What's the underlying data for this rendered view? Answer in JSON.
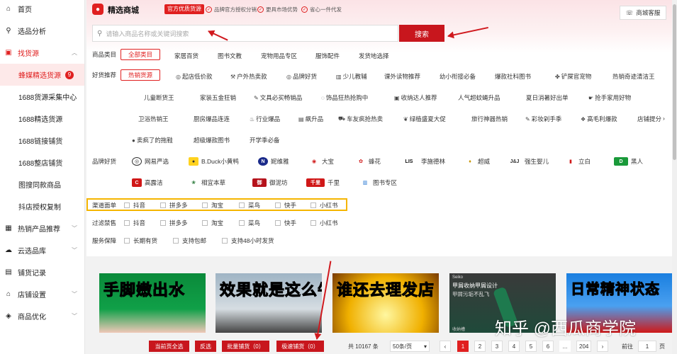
{
  "sidebar": {
    "items": [
      {
        "label": "首页",
        "icon": "home-icon"
      },
      {
        "label": "选品分析",
        "icon": "search-icon"
      },
      {
        "label": "找货源",
        "icon": "box-icon"
      },
      {
        "label": "热销产品推荐",
        "icon": "grid-icon"
      },
      {
        "label": "云选品库",
        "icon": "cloud-icon"
      },
      {
        "label": "铺货记录",
        "icon": "record-icon"
      },
      {
        "label": "店铺设置",
        "icon": "store-icon"
      },
      {
        "label": "商品优化",
        "icon": "optimize-icon"
      }
    ],
    "subitems": [
      {
        "label": "蜂媒精选货源",
        "badge": "9"
      },
      {
        "label": "1688货源采集中心"
      },
      {
        "label": "1688精选货源"
      },
      {
        "label": "1688链接铺货"
      },
      {
        "label": "1688整店铺货"
      },
      {
        "label": "图搜同款商品"
      },
      {
        "label": "抖店授权复制"
      }
    ]
  },
  "header": {
    "brand": "精选商城",
    "tag": "官方优质货源",
    "promos": [
      "品牌官方授权分销",
      "更具市场优势",
      "省心一件代发"
    ],
    "service": "商城客服"
  },
  "search": {
    "placeholder": "请输入商品名称或关键词搜索",
    "button": "搜索"
  },
  "category": {
    "label": "商品类目",
    "active": "全部类目",
    "options": [
      "家居百货",
      "图书文教",
      "宠物用品专区",
      "服饰配件",
      "发货地选择"
    ]
  },
  "recommend": {
    "label": "好货推荐",
    "active": "热销货源",
    "row1": [
      "起店低价款",
      "户外热卖款",
      "品牌好货",
      "少儿教辅",
      "课外读物推荐",
      "幼小衔接必备",
      "爆款社科图书",
      "铲屎官宠物",
      "热销奇迹清洁王"
    ],
    "row2": [
      "儿童断货王",
      "家装五金狂销",
      "文具必买畅销品",
      "饰品狂热抢购中",
      "收纳达人推荐",
      "人气超蚊蝇升品",
      "夏日消暑好出单",
      "抢手家用好物"
    ],
    "row3": [
      "卫浴热销王",
      "厨房爆品连连",
      "行业爆品",
      "飙升品",
      "车友疯抢热卖",
      "绿植盛夏大促",
      "旅行神器热销",
      "彩妆剁手季",
      "高毛利爆款",
      "店铺提分"
    ],
    "row4": [
      "卖疯了的拖鞋",
      "超级爆款图书",
      "开学季必备"
    ]
  },
  "brands": {
    "label": "品牌好货",
    "row1": [
      "网易严选",
      "B.Duck小黄鸭",
      "妮维雅",
      "大宝",
      "蜂花",
      "李施德林",
      "超威",
      "强生婴儿",
      "立白",
      "黑人"
    ],
    "row2": [
      "高露洁",
      "相宜本草",
      "御泥坊",
      "千里",
      "图书专区"
    ]
  },
  "channel": {
    "label": "渠道面单",
    "options": [
      "抖音",
      "拼多多",
      "淘宝",
      "菜鸟",
      "快手",
      "小红书"
    ]
  },
  "filter": {
    "label": "过滤禁售",
    "options": [
      "抖音",
      "拼多多",
      "淘宝",
      "菜鸟",
      "快手",
      "小红书"
    ]
  },
  "service_guarantee": {
    "label": "服务保障",
    "options": [
      "长期有货",
      "支持包邮",
      "支持48小时发货"
    ]
  },
  "products": [
    {
      "caption": "手脚嫩出水"
    },
    {
      "caption": "效果就是这么牛"
    },
    {
      "caption": "谁还去理发店"
    },
    {
      "caption": "",
      "title": "甲屑收纳甲屑设计",
      "subtitle": "甲屑污垢不乱飞",
      "brand": "Seiko",
      "tag": "收纳槽"
    },
    {
      "caption": "日常精神状态"
    }
  ],
  "watermark": "知乎 @西瓜商学院",
  "bottom": {
    "select_page": "当前页全选",
    "invert": "反选",
    "batch": "批量铺货（0）",
    "quick": "极速铺货（0）",
    "total": "共 10167 条",
    "page_size": "50条/页",
    "pages": [
      "1",
      "2",
      "3",
      "4",
      "5",
      "6",
      "...",
      "204"
    ],
    "goto_label": "前往",
    "goto_value": "1",
    "goto_suffix": "页"
  }
}
